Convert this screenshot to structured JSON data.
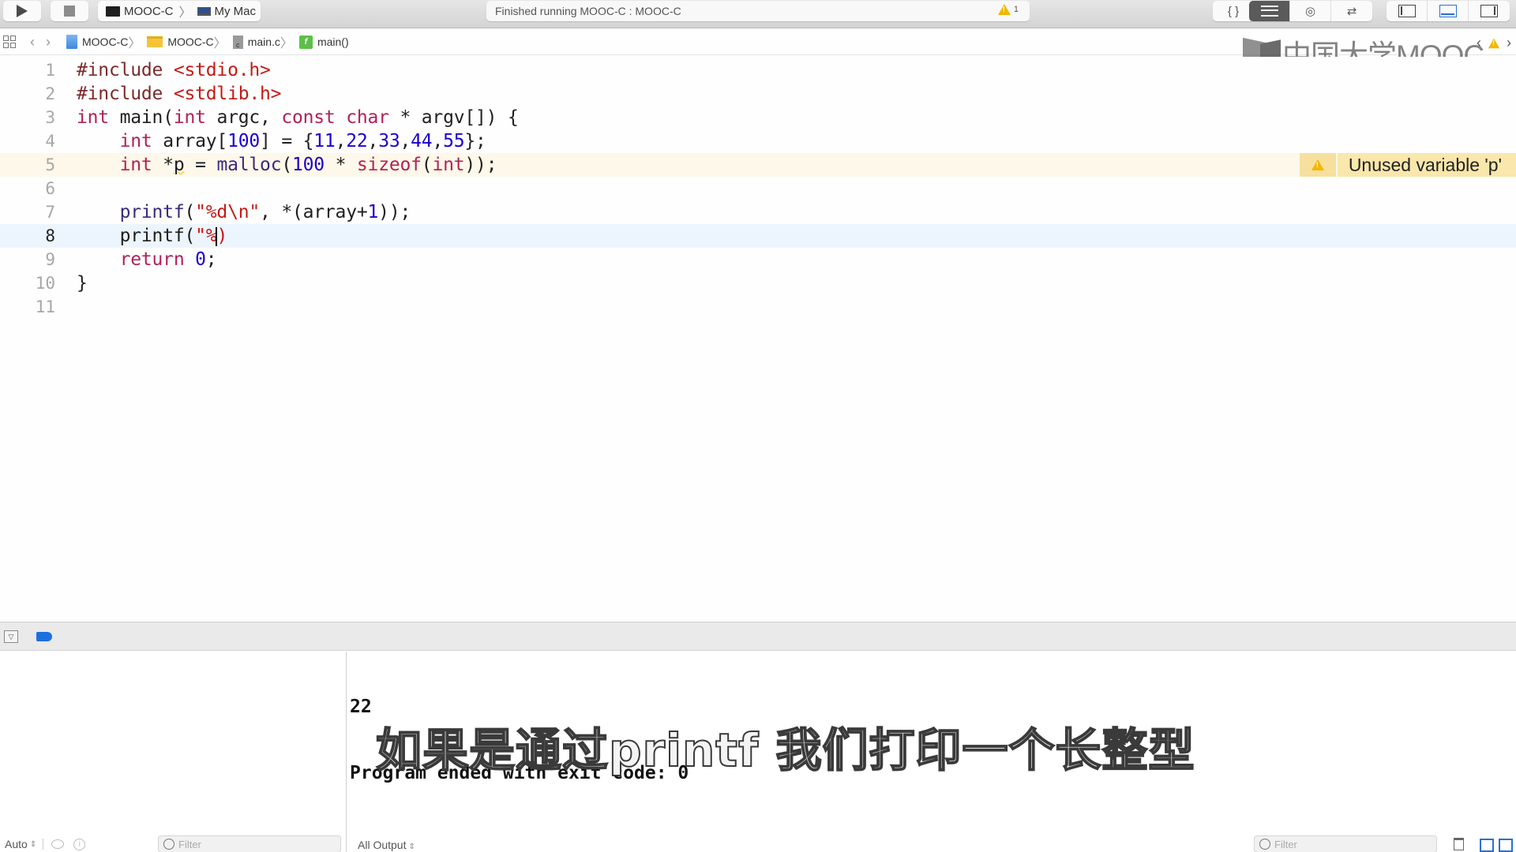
{
  "toolbar": {
    "scheme": "MOOC-C",
    "destination": "My Mac",
    "status": "Finished running MOOC-C : MOOC-C",
    "warning_count": "1",
    "editor_buttons": [
      "standard-editor",
      "assistant-editor",
      "version-editor"
    ],
    "view_buttons": [
      "navigator",
      "debug-area",
      "utilities"
    ],
    "braces_label": "{ }"
  },
  "jumpbar": {
    "crumbs": [
      {
        "label": "MOOC-C",
        "icon": "project-icon"
      },
      {
        "label": "MOOC-C",
        "icon": "folder-icon"
      },
      {
        "label": "main.c",
        "icon": "c-file-icon"
      },
      {
        "label": "main()",
        "icon": "function-icon"
      }
    ],
    "func_glyph": "f",
    "cfile_glyph": "c"
  },
  "watermark": "中国大学MOOC",
  "editor": {
    "lines": [
      {
        "n": "1"
      },
      {
        "n": "2"
      },
      {
        "n": "3"
      },
      {
        "n": "4"
      },
      {
        "n": "5"
      },
      {
        "n": "6"
      },
      {
        "n": "7"
      },
      {
        "n": "8"
      },
      {
        "n": "9"
      },
      {
        "n": "10"
      },
      {
        "n": "11"
      }
    ],
    "code": {
      "l1_pp": "#include ",
      "l1_hdr": "<stdio.h>",
      "l2_pp": "#include ",
      "l2_hdr": "<stdlib.h>",
      "l3_kw1": "int",
      "l3_a": " main(",
      "l3_kw2": "int",
      "l3_b": " argc, ",
      "l3_kw3": "const",
      "l3_sp": " ",
      "l3_kw4": "char",
      "l3_c": " * argv[]) {",
      "l4_indent": "    ",
      "l4_kw": "int",
      "l4_a": " array[",
      "l4_n1": "100",
      "l4_b": "] = {",
      "l4_n2": "11",
      "l4_c1": ",",
      "l4_n3": "22",
      "l4_c2": ",",
      "l4_n4": "33",
      "l4_c3": ",",
      "l4_n5": "44",
      "l4_c4": ",",
      "l4_n6": "55",
      "l4_d": "};",
      "l5_indent": "    ",
      "l5_kw": "int",
      "l5_a": " *",
      "l5_var": "p",
      "l5_b": " = ",
      "l5_fn": "malloc",
      "l5_c": "(",
      "l5_n": "100",
      "l5_d": " * ",
      "l5_kw2": "sizeof",
      "l5_e": "(",
      "l5_kw3": "int",
      "l5_f": "));",
      "l7_indent": "    ",
      "l7_fn": "printf",
      "l7_a": "(",
      "l7_str": "\"%d\\n\"",
      "l7_b": ", *(array+",
      "l7_n": "1",
      "l7_c": "));",
      "l8_indent": "    ",
      "l8_fn": "printf",
      "l8_a": "(",
      "l8_str": "\"%",
      "l8_after": ")",
      "l9_indent": "    ",
      "l9_kw": "return",
      "l9_sp": " ",
      "l9_n": "0",
      "l9_end": ";",
      "l10": "}"
    },
    "warning_annotation": "Unused variable 'p'"
  },
  "console": {
    "output_lines": [
      "22",
      "Program ended with exit code: 0"
    ],
    "subtitle": "如果是通过printf 我们打印一个长整型"
  },
  "footer": {
    "variables_scope": "Auto",
    "variables_filter_placeholder": "Filter",
    "console_output_mode": "All Output",
    "console_filter_placeholder": "Filter"
  }
}
